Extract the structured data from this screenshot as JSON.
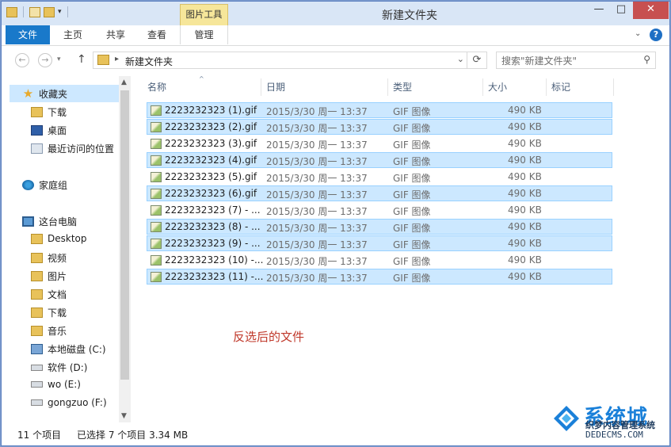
{
  "window": {
    "title": "新建文件夹",
    "context_tab": "图片工具",
    "min_glyph": "—",
    "max_glyph": "□",
    "close_glyph": "✕"
  },
  "ribbon": {
    "tabs": [
      "文件",
      "主页",
      "共享",
      "查看",
      "管理"
    ],
    "collapse_glyph": "⌄",
    "help_glyph": "?"
  },
  "address": {
    "back_glyph": "←",
    "forward_glyph": "→",
    "up_glyph": "↑",
    "separator": "▸",
    "crumb": "新建文件夹",
    "dropdown_glyph": "⌄",
    "refresh_glyph": "⟳"
  },
  "search": {
    "placeholder": "搜索\"新建文件夹\"",
    "icon": "search-icon"
  },
  "nav": {
    "favorites_label": "收藏夹",
    "favorites": [
      "下载",
      "桌面",
      "最近访问的位置"
    ],
    "homegroup_label": "家庭组",
    "thispc_label": "这台电脑",
    "thispc_items": [
      "Desktop",
      "视频",
      "图片",
      "文档",
      "下载",
      "音乐",
      "本地磁盘 (C:)",
      "软件 (D:)",
      "wo (E:)",
      "gongzuo (F:)"
    ],
    "scroll_up_glyph": "▲",
    "scroll_down_glyph": "▼"
  },
  "columns": {
    "name": "名称",
    "date": "日期",
    "type": "类型",
    "size": "大小",
    "tags": "标记",
    "sort_glyph": "^"
  },
  "files": [
    {
      "name": "2223232323 (1).gif",
      "date": "2015/3/30 周一 13:37",
      "type": "GIF 图像",
      "size": "490 KB",
      "selected": true
    },
    {
      "name": "2223232323 (2).gif",
      "date": "2015/3/30 周一 13:37",
      "type": "GIF 图像",
      "size": "490 KB",
      "selected": true
    },
    {
      "name": "2223232323 (3).gif",
      "date": "2015/3/30 周一 13:37",
      "type": "GIF 图像",
      "size": "490 KB",
      "selected": false
    },
    {
      "name": "2223232323 (4).gif",
      "date": "2015/3/30 周一 13:37",
      "type": "GIF 图像",
      "size": "490 KB",
      "selected": true
    },
    {
      "name": "2223232323 (5).gif",
      "date": "2015/3/30 周一 13:37",
      "type": "GIF 图像",
      "size": "490 KB",
      "selected": false
    },
    {
      "name": "2223232323 (6).gif",
      "date": "2015/3/30 周一 13:37",
      "type": "GIF 图像",
      "size": "490 KB",
      "selected": true
    },
    {
      "name": "2223232323 (7) - ...",
      "date": "2015/3/30 周一 13:37",
      "type": "GIF 图像",
      "size": "490 KB",
      "selected": false
    },
    {
      "name": "2223232323 (8) - ...",
      "date": "2015/3/30 周一 13:37",
      "type": "GIF 图像",
      "size": "490 KB",
      "selected": true
    },
    {
      "name": "2223232323 (9) - ...",
      "date": "2015/3/30 周一 13:37",
      "type": "GIF 图像",
      "size": "490 KB",
      "selected": true
    },
    {
      "name": "2223232323 (10) -...",
      "date": "2015/3/30 周一 13:37",
      "type": "GIF 图像",
      "size": "490 KB",
      "selected": false
    },
    {
      "name": "2223232323 (11) -...",
      "date": "2015/3/30 周一 13:37",
      "type": "GIF 图像",
      "size": "490 KB",
      "selected": true
    }
  ],
  "annotation": "反选后的文件",
  "status": {
    "count": "11 个项目",
    "selected": "已选择 7 个项目 3.34 MB"
  },
  "watermark": {
    "brand": "系统城",
    "sub": "织梦内容管理系统",
    "url": "DEDECMS.COM"
  },
  "colors": {
    "accent": "#1979ca",
    "selection": "#cce8ff",
    "selection_border": "#99d1ff",
    "annotation": "#c0392b"
  }
}
